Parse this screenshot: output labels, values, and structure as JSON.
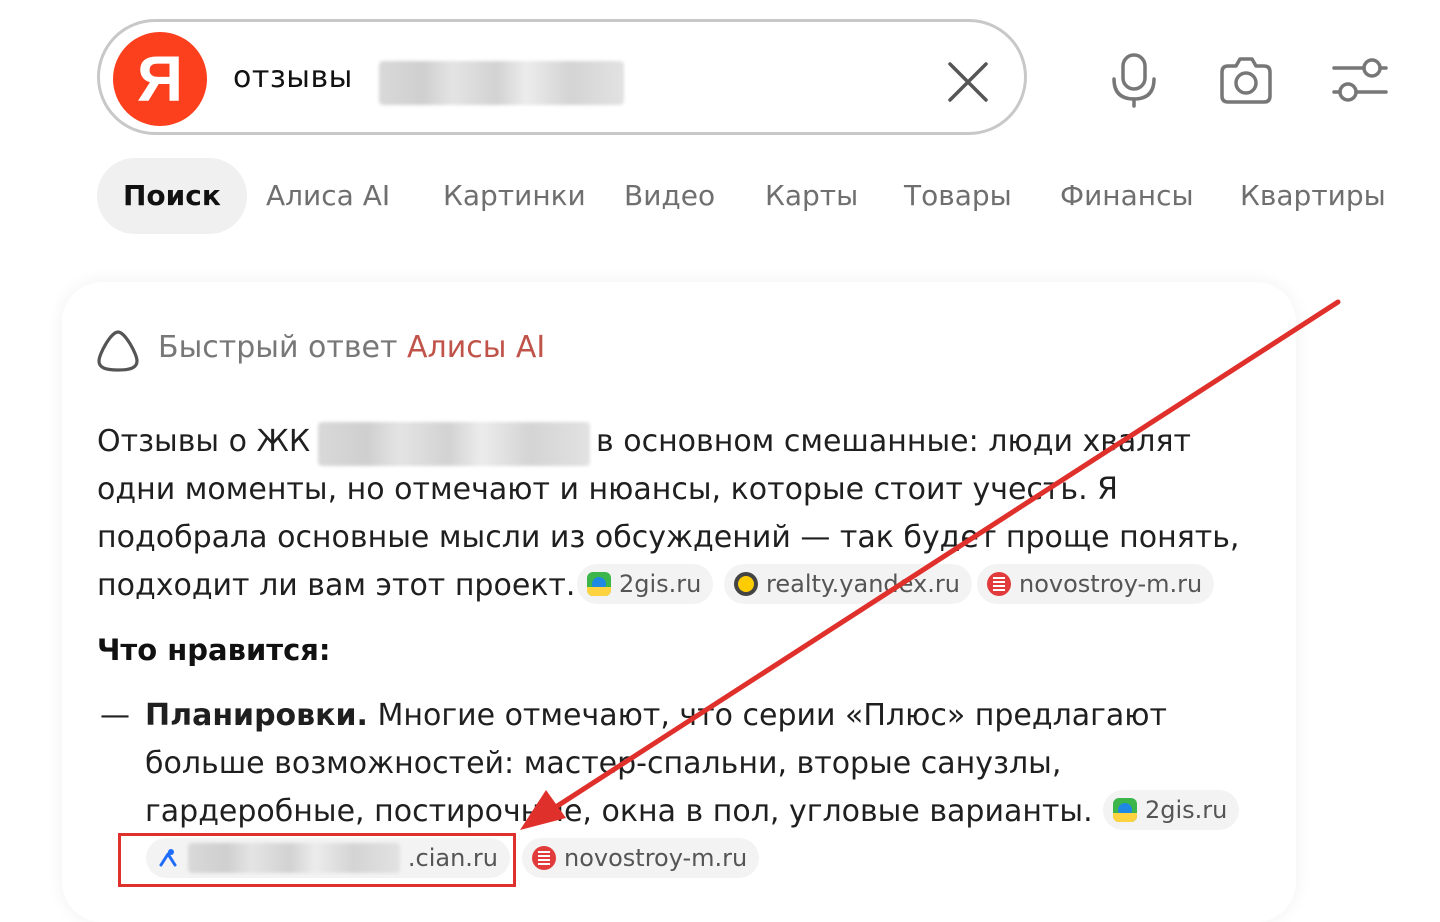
{
  "search": {
    "logo_letter": "Я",
    "query": "отзывы"
  },
  "icons": {
    "clear": "close-icon",
    "voice": "microphone-icon",
    "camera": "camera-icon",
    "settings": "filter-settings-icon",
    "alice": "alice-icon"
  },
  "tabs": [
    {
      "label": "Поиск"
    },
    {
      "label": "Алиса AI"
    },
    {
      "label": "Картинки"
    },
    {
      "label": "Видео"
    },
    {
      "label": "Карты"
    },
    {
      "label": "Товары"
    },
    {
      "label": "Финансы"
    },
    {
      "label": "Квартиры"
    }
  ],
  "answer": {
    "title_prefix": "Быстрый ответ",
    "title_accent": "Алисы AI",
    "line1_start": "Отзывы о ЖК",
    "line1_end": "в основном смешанные: люди хвалят",
    "line2": "одни моменты, но отмечают и нюансы, которые стоит учесть. Я",
    "line3": "подобрала основные мысли из обсуждений — так будет проще понять,",
    "line4": "подходит ли вам этот проект.",
    "sources_1": [
      "2gis.ru",
      "realty.yandex.ru",
      "novostroy-m.ru"
    ],
    "likes_heading": "Что нравится:",
    "bullet_dash": "—",
    "bullet_bold": "Планировки.",
    "bullet_line1": "Многие отмечают, что серии «Плюс» предлагают",
    "bullet_line2": "больше возможностей: мастер-спальни, вторые санузлы,",
    "bullet_line3": "гардеробные, постирочные, окна в пол, угловые варианты.",
    "sources_2": [
      "2gis.ru",
      ".cian.ru",
      "novostroy-m.ru"
    ]
  },
  "colors": {
    "yandex_red": "#fc3f1d",
    "accent": "#c0534a",
    "annotation_red": "#e0302c"
  }
}
